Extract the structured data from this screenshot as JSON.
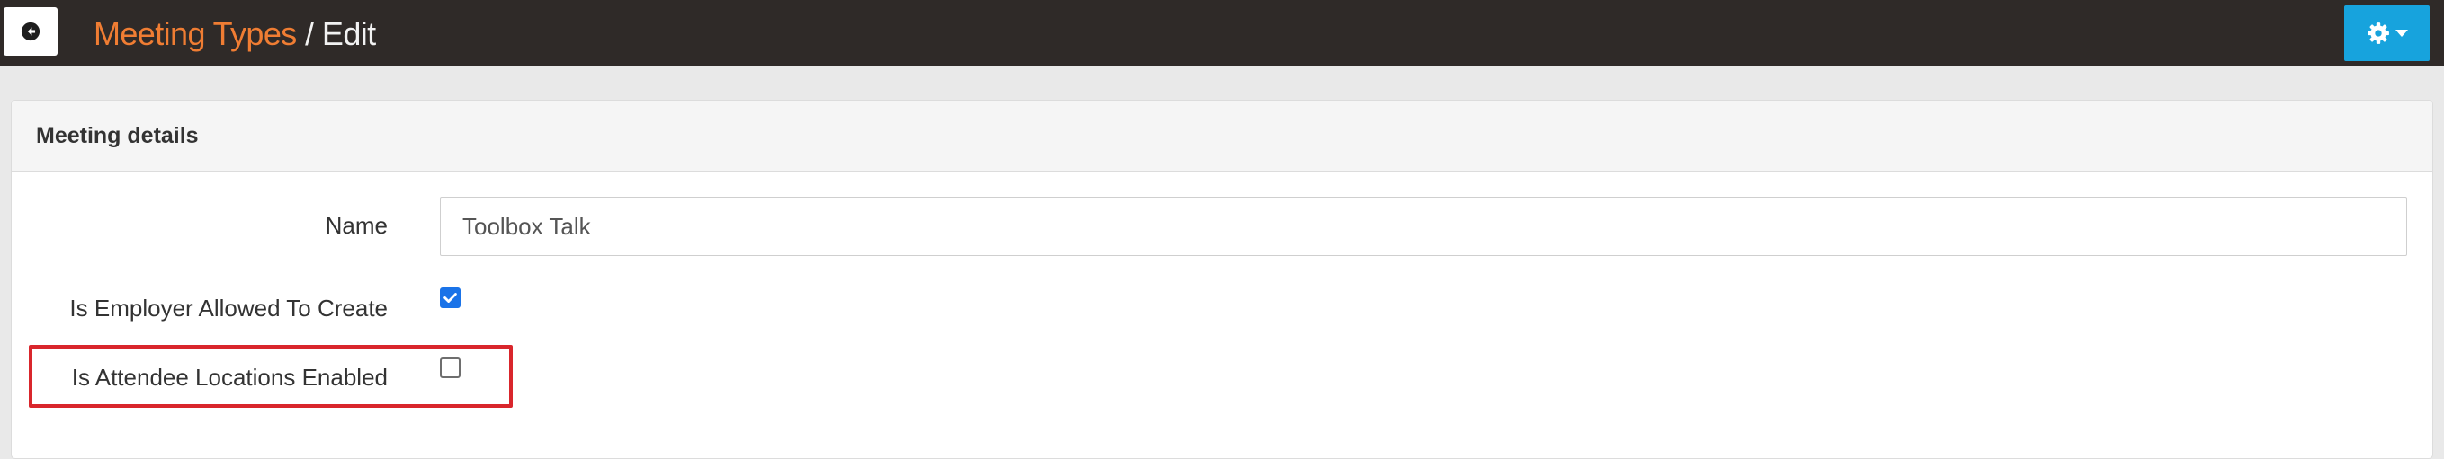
{
  "header": {
    "breadcrumb_parent": "Meeting Types",
    "breadcrumb_separator": " / ",
    "breadcrumb_current": "Edit",
    "back_icon": "arrow-left-circle-icon",
    "settings_icon": "gear-icon",
    "settings_caret_icon": "chevron-down-icon"
  },
  "panel": {
    "title": "Meeting details",
    "fields": {
      "name": {
        "label": "Name",
        "value": "Toolbox Talk"
      },
      "employer_allowed": {
        "label": "Is Employer Allowed To Create",
        "checked": true
      },
      "attendee_locations": {
        "label": "Is Attendee Locations Enabled",
        "checked": false
      }
    }
  },
  "colors": {
    "topbar": "#2f2a28",
    "breadcrumb_link": "#f07d33",
    "settings_button": "#17a3dd",
    "checkbox_checked": "#1a73e8",
    "highlight": "#d9262c"
  }
}
